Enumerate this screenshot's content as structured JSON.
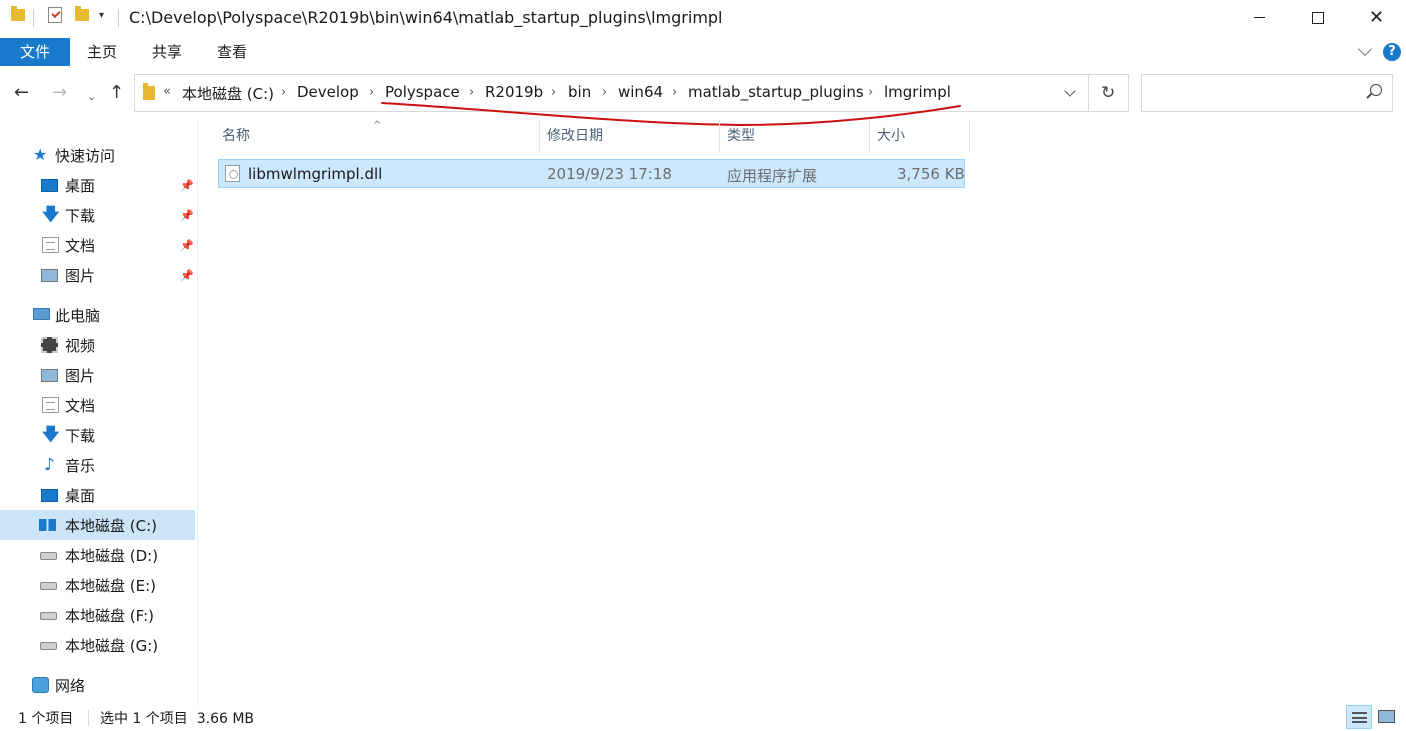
{
  "window": {
    "title": "C:\\Develop\\Polyspace\\R2019b\\bin\\win64\\matlab_startup_plugins\\lmgrimpl",
    "minimize_icon": "minimize-icon",
    "maximize_icon": "maximize-icon",
    "close_glyph": "✕"
  },
  "ribbon": {
    "tabs": [
      "文件",
      "主页",
      "共享",
      "查看"
    ],
    "help_glyph": "?"
  },
  "nav": {
    "back_glyph": "←",
    "forward_glyph": "→",
    "recent_glyph": "⌄",
    "up_glyph": "↑",
    "overflow_glyph": "«",
    "breadcrumbs": [
      "本地磁盘 (C:)",
      "Develop",
      "Polyspace",
      "R2019b",
      "bin",
      "win64",
      "matlab_startup_plugins",
      "lmgrimpl"
    ],
    "crumb_separator": "›",
    "refresh_glyph": "↻",
    "search_placeholder": ""
  },
  "sidebar": {
    "pin_glyph": "📌",
    "quick_access": {
      "label": "快速访问",
      "icon": "star-icon"
    },
    "quick_items": [
      {
        "label": "桌面",
        "icon": "desktop-icon"
      },
      {
        "label": "下载",
        "icon": "download-icon"
      },
      {
        "label": "文档",
        "icon": "document-icon"
      },
      {
        "label": "图片",
        "icon": "pictures-icon"
      }
    ],
    "this_pc": {
      "label": "此电脑",
      "icon": "computer-icon"
    },
    "pc_items": [
      {
        "label": "视频",
        "icon": "video-icon"
      },
      {
        "label": "图片",
        "icon": "pictures-icon"
      },
      {
        "label": "文档",
        "icon": "document-icon"
      },
      {
        "label": "下载",
        "icon": "download-icon"
      },
      {
        "label": "音乐",
        "icon": "music-icon"
      },
      {
        "label": "桌面",
        "icon": "desktop-icon"
      },
      {
        "label": "本地磁盘 (C:)",
        "icon": "windows-drive-icon"
      },
      {
        "label": "本地磁盘 (D:)",
        "icon": "drive-icon"
      },
      {
        "label": "本地磁盘 (E:)",
        "icon": "drive-icon"
      },
      {
        "label": "本地磁盘 (F:)",
        "icon": "drive-icon"
      },
      {
        "label": "本地磁盘 (G:)",
        "icon": "drive-icon"
      }
    ],
    "network": {
      "label": "网络",
      "icon": "network-icon"
    }
  },
  "file_list": {
    "columns": [
      "名称",
      "修改日期",
      "类型",
      "大小"
    ],
    "sort_glyph": "^",
    "rows": [
      {
        "name": "libmwlmgrimpl.dll",
        "modified": "2019/9/23 17:18",
        "type": "应用程序扩展",
        "size": "3,756 KB",
        "icon": "dll-file-icon"
      }
    ]
  },
  "status": {
    "item_count": "1 个项目",
    "selection": "选中 1 个项目  3.66 MB"
  },
  "colors": {
    "accent": "#1979ca",
    "selection_bg": "#cce8ff",
    "annotation": "#cc1010"
  }
}
